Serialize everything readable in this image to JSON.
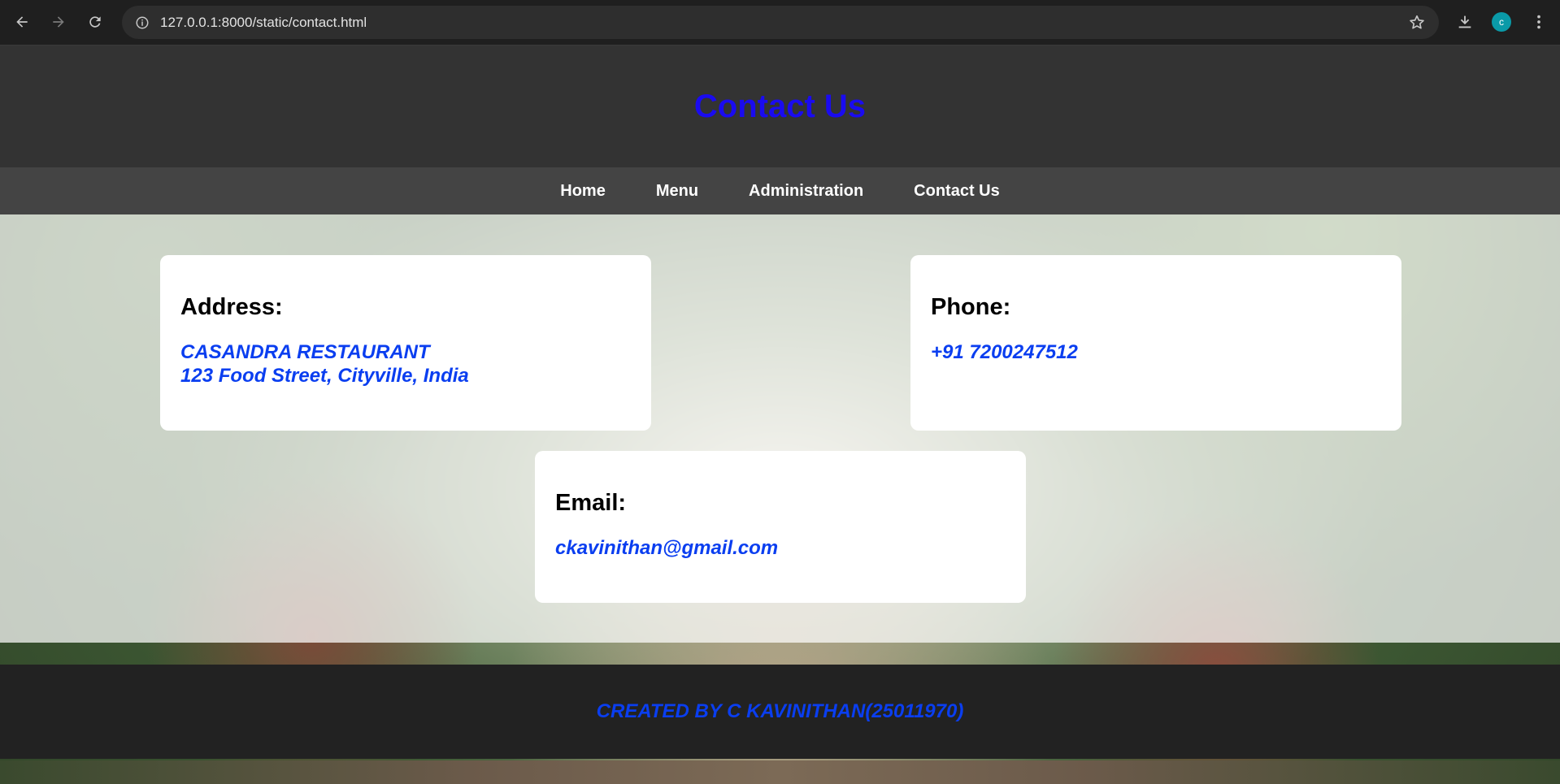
{
  "browser": {
    "url": "127.0.0.1:8000/static/contact.html",
    "avatar_letter": "c"
  },
  "page": {
    "title": "Contact Us",
    "nav": {
      "home": "Home",
      "menu": "Menu",
      "administration": "Administration",
      "contact": "Contact Us"
    },
    "address": {
      "heading": "Address:",
      "line1": "CASANDRA RESTAURANT",
      "line2": "123 Food Street, Cityville, India"
    },
    "phone": {
      "heading": "Phone:",
      "value": "+91 7200247512"
    },
    "email": {
      "heading": "Email:",
      "value": "ckavinithan@gmail.com"
    },
    "footer": "CREATED BY C KAVINITHAN(25011970)"
  },
  "colors": {
    "title": "#1a0bf0",
    "info_text": "#0a3ef0",
    "header_bg": "#333333",
    "nav_bg": "#444444",
    "footer_bg": "#222222",
    "avatar_bg": "#0a9aa8"
  },
  "icons": [
    "back-arrow-icon",
    "forward-arrow-icon",
    "reload-icon",
    "site-info-icon",
    "star-icon",
    "download-icon",
    "more-vert-icon"
  ]
}
